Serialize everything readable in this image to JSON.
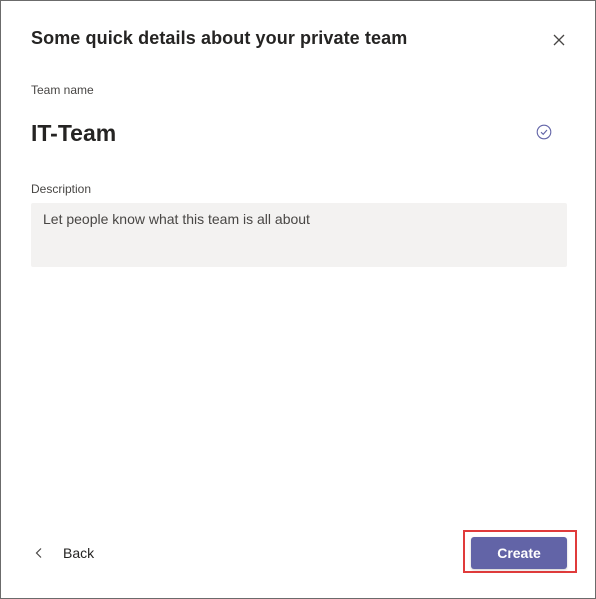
{
  "dialog": {
    "title": "Some quick details about your private team",
    "close_icon": "close-icon"
  },
  "team_name": {
    "label": "Team name",
    "value": "IT-Team",
    "status_icon": "check-circle-icon"
  },
  "description": {
    "label": "Description",
    "placeholder": "Let people know what this team is all about",
    "value": ""
  },
  "footer": {
    "back_label": "Back",
    "back_icon": "chevron-left-icon",
    "create_label": "Create"
  },
  "colors": {
    "primary": "#6264a7",
    "highlight": "#e03b3b",
    "input_bg": "#f3f2f1"
  }
}
